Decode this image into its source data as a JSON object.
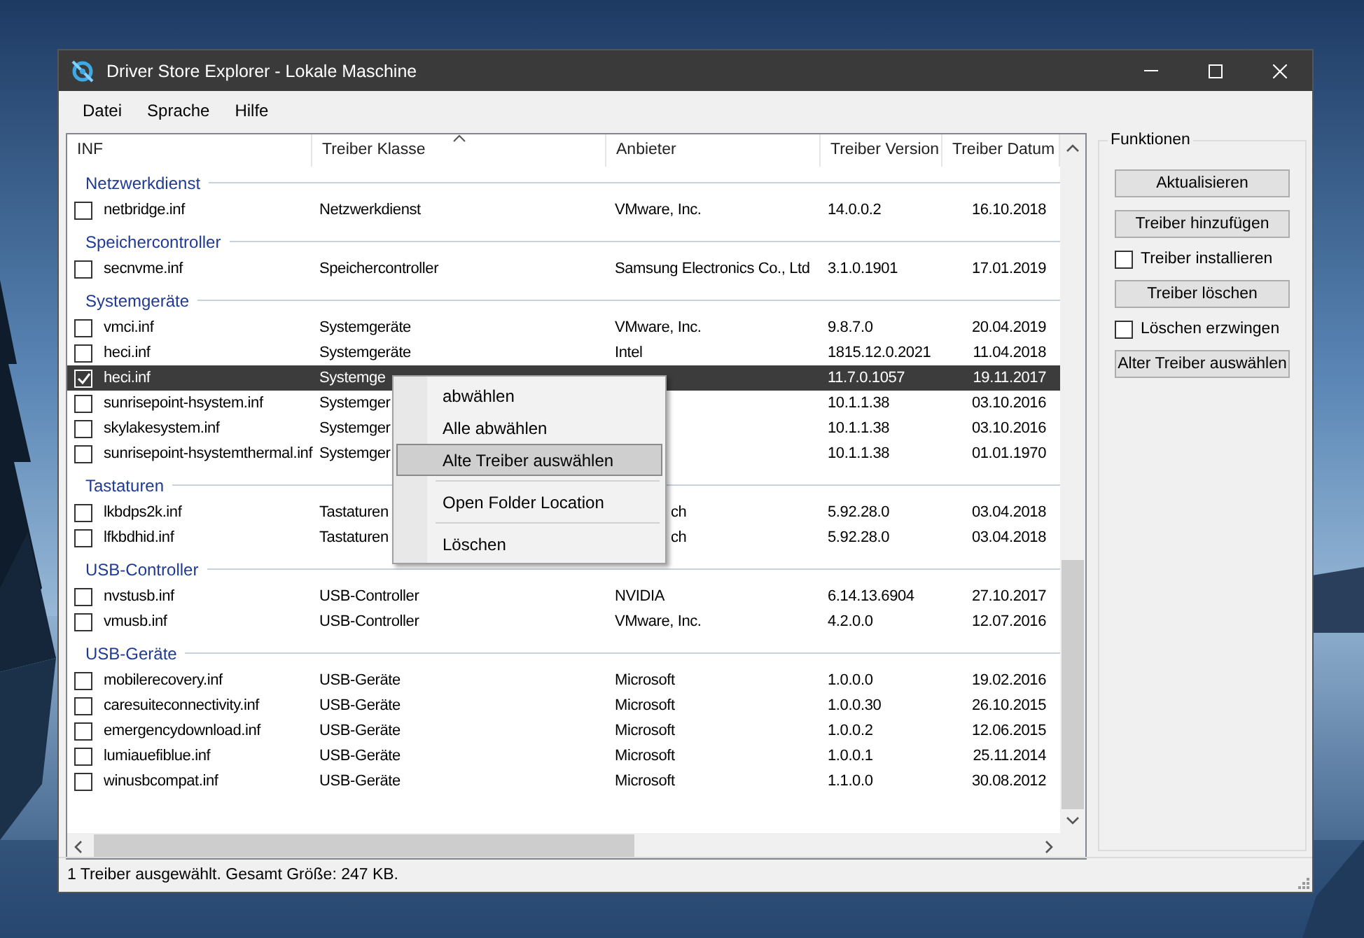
{
  "window": {
    "title": "Driver Store Explorer - Lokale Maschine"
  },
  "menu_bar": [
    "Datei",
    "Sprache",
    "Hilfe"
  ],
  "table": {
    "columns": [
      {
        "label": "INF",
        "sorted": false
      },
      {
        "label": "Treiber Klasse",
        "sorted": true
      },
      {
        "label": "Anbieter",
        "sorted": false
      },
      {
        "label": "Treiber Version",
        "sorted": false
      },
      {
        "label": "Treiber Datum",
        "sorted": false
      }
    ],
    "groups": [
      {
        "name": "Netzwerkdienst",
        "rows": [
          {
            "inf": "netbridge.inf",
            "class": "Netzwerkdienst",
            "provider": "VMware, Inc.",
            "version": "14.0.0.2",
            "date": "16.10.2018",
            "checked": false,
            "selected": false
          }
        ]
      },
      {
        "name": "Speichercontroller",
        "rows": [
          {
            "inf": "secnvme.inf",
            "class": "Speichercontroller",
            "provider": "Samsung Electronics Co., Ltd",
            "version": "3.1.0.1901",
            "date": "17.01.2019",
            "checked": false,
            "selected": false
          }
        ]
      },
      {
        "name": "Systemgeräte",
        "rows": [
          {
            "inf": "vmci.inf",
            "class": "Systemgeräte",
            "provider": "VMware, Inc.",
            "version": "9.8.7.0",
            "date": "20.04.2019",
            "checked": false,
            "selected": false
          },
          {
            "inf": "heci.inf",
            "class": "Systemgeräte",
            "provider": "Intel",
            "version": "1815.12.0.2021",
            "date": "11.04.2018",
            "checked": false,
            "selected": false
          },
          {
            "inf": "heci.inf",
            "class": "Systemge",
            "version": "11.7.0.1057",
            "date": "19.11.2017",
            "checked": true,
            "selected": true
          },
          {
            "inf": "sunrisepoint-hsystem.inf",
            "class": "Systemger",
            "version": "10.1.1.38",
            "date": "03.10.2016",
            "checked": false,
            "selected": false
          },
          {
            "inf": "skylakesystem.inf",
            "class": "Systemger",
            "version": "10.1.1.38",
            "date": "03.10.2016",
            "checked": false,
            "selected": false
          },
          {
            "inf": "sunrisepoint-hsystemthermal.inf",
            "class": "Systemger",
            "version": "10.1.1.38",
            "date": "01.01.1970",
            "checked": false,
            "selected": false
          }
        ]
      },
      {
        "name": "Tastaturen",
        "rows": [
          {
            "inf": "lkbdps2k.inf",
            "class": "Tastaturen",
            "provider": "ch",
            "version": "5.92.28.0",
            "date": "03.04.2018",
            "checked": false,
            "selected": false
          },
          {
            "inf": "lfkbdhid.inf",
            "class": "Tastaturen",
            "provider": "ch",
            "version": "5.92.28.0",
            "date": "03.04.2018",
            "checked": false,
            "selected": false
          }
        ]
      },
      {
        "name": "USB-Controller",
        "rows": [
          {
            "inf": "nvstusb.inf",
            "class": "USB-Controller",
            "provider": "NVIDIA",
            "version": "6.14.13.6904",
            "date": "27.10.2017",
            "checked": false,
            "selected": false
          },
          {
            "inf": "vmusb.inf",
            "class": "USB-Controller",
            "provider": "VMware, Inc.",
            "version": "4.2.0.0",
            "date": "12.07.2016",
            "checked": false,
            "selected": false
          }
        ]
      },
      {
        "name": "USB-Geräte",
        "rows": [
          {
            "inf": "mobilerecovery.inf",
            "class": "USB-Geräte",
            "provider": "Microsoft",
            "version": "1.0.0.0",
            "date": "19.02.2016",
            "checked": false,
            "selected": false
          },
          {
            "inf": "caresuiteconnectivity.inf",
            "class": "USB-Geräte",
            "provider": "Microsoft",
            "version": "1.0.0.30",
            "date": "26.10.2015",
            "checked": false,
            "selected": false
          },
          {
            "inf": "emergencydownload.inf",
            "class": "USB-Geräte",
            "provider": "Microsoft",
            "version": "1.0.0.2",
            "date": "12.06.2015",
            "checked": false,
            "selected": false
          },
          {
            "inf": "lumiauefiblue.inf",
            "class": "USB-Geräte",
            "provider": "Microsoft",
            "version": "1.0.0.1",
            "date": "25.11.2014",
            "checked": false,
            "selected": false
          },
          {
            "inf": "winusbcompat.inf",
            "class": "USB-Geräte",
            "provider": "Microsoft",
            "version": "1.1.0.0",
            "date": "30.08.2012",
            "checked": false,
            "selected": false
          }
        ]
      }
    ]
  },
  "context_menu": {
    "items": [
      {
        "kind": "item",
        "label": "abwählen",
        "selected": false
      },
      {
        "kind": "item",
        "label": "Alle abwählen",
        "selected": false
      },
      {
        "kind": "item",
        "label": "Alte Treiber auswählen",
        "selected": true
      },
      {
        "kind": "separator"
      },
      {
        "kind": "item",
        "label": "Open Folder Location",
        "selected": false
      },
      {
        "kind": "separator"
      },
      {
        "kind": "item",
        "label": "Löschen",
        "selected": false
      }
    ]
  },
  "functions": {
    "title": "Funktionen",
    "controls": [
      {
        "kind": "button",
        "label": "Aktualisieren"
      },
      {
        "kind": "button",
        "label": "Treiber hinzufügen"
      },
      {
        "kind": "checkbox",
        "label": "Treiber installieren",
        "checked": false
      },
      {
        "kind": "button",
        "label": "Treiber löschen"
      },
      {
        "kind": "checkbox",
        "label": "Löschen erzwingen",
        "checked": false
      },
      {
        "kind": "button",
        "label": "Alter Treiber auswählen"
      }
    ]
  },
  "status_bar": "1 Treiber ausgewählt. Gesamt Größe: 247 KB."
}
